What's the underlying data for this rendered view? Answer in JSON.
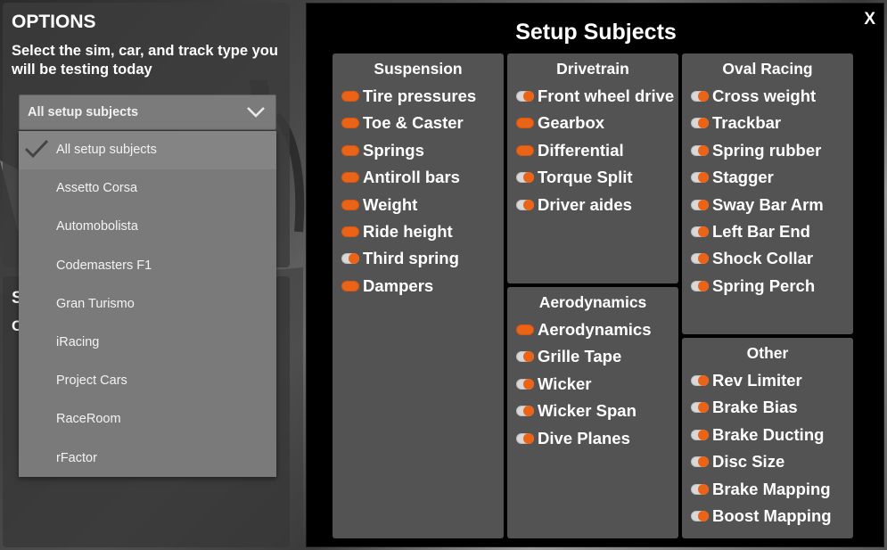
{
  "options": {
    "title": "OPTIONS",
    "description": "Select the sim, car, and track type you will be testing today",
    "select_value": "All setup subjects",
    "dropdown_items": [
      {
        "label": "All setup subjects",
        "selected": true
      },
      {
        "label": "Assetto Corsa",
        "selected": false
      },
      {
        "label": "Automobolista",
        "selected": false
      },
      {
        "label": "Codemasters F1",
        "selected": false
      },
      {
        "label": "Gran Turismo",
        "selected": false
      },
      {
        "label": "iRacing",
        "selected": false
      },
      {
        "label": "Project Cars",
        "selected": false
      },
      {
        "label": "RaceRoom",
        "selected": false
      },
      {
        "label": "rFactor",
        "selected": false
      }
    ],
    "second_panel_stub": [
      "S",
      "C"
    ]
  },
  "modal": {
    "title": "Setup Subjects",
    "close_label": "X",
    "groups": {
      "suspension": {
        "title": "Suspension",
        "items": [
          {
            "label": "Tire pressures",
            "on": true
          },
          {
            "label": "Toe & Caster",
            "on": true
          },
          {
            "label": "Springs",
            "on": true
          },
          {
            "label": "Antiroll bars",
            "on": true
          },
          {
            "label": "Weight",
            "on": true
          },
          {
            "label": "Ride height",
            "on": true
          },
          {
            "label": "Third spring",
            "on": false
          },
          {
            "label": "Dampers",
            "on": true
          }
        ]
      },
      "drivetrain": {
        "title": "Drivetrain",
        "items": [
          {
            "label": "Front wheel drive",
            "on": false
          },
          {
            "label": "Gearbox",
            "on": true
          },
          {
            "label": "Differential",
            "on": true
          },
          {
            "label": "Torque Split",
            "on": false
          },
          {
            "label": "Driver aides",
            "on": false
          }
        ]
      },
      "aerodynamics": {
        "title": "Aerodynamics",
        "items": [
          {
            "label": "Aerodynamics",
            "on": true
          },
          {
            "label": "Grille Tape",
            "on": false
          },
          {
            "label": "Wicker",
            "on": false
          },
          {
            "label": "Wicker Span",
            "on": false
          },
          {
            "label": "Dive Planes",
            "on": false
          }
        ]
      },
      "oval_racing": {
        "title": "Oval Racing",
        "items": [
          {
            "label": "Cross weight",
            "on": false
          },
          {
            "label": "Trackbar",
            "on": false
          },
          {
            "label": "Spring rubber",
            "on": false
          },
          {
            "label": "Stagger",
            "on": false
          },
          {
            "label": "Sway Bar Arm",
            "on": false
          },
          {
            "label": "Left Bar End",
            "on": false
          },
          {
            "label": "Shock Collar",
            "on": false
          },
          {
            "label": "Spring Perch",
            "on": false
          }
        ]
      },
      "other": {
        "title": "Other",
        "items": [
          {
            "label": "Rev Limiter",
            "on": false
          },
          {
            "label": "Brake Bias",
            "on": false
          },
          {
            "label": "Brake Ducting",
            "on": false
          },
          {
            "label": "Disc Size",
            "on": false
          },
          {
            "label": "Brake Mapping",
            "on": false
          },
          {
            "label": "Boost Mapping",
            "on": false
          }
        ]
      }
    }
  },
  "colors": {
    "accent": "#eb6316",
    "panel": "#535353",
    "modal_bg": "#000000"
  }
}
